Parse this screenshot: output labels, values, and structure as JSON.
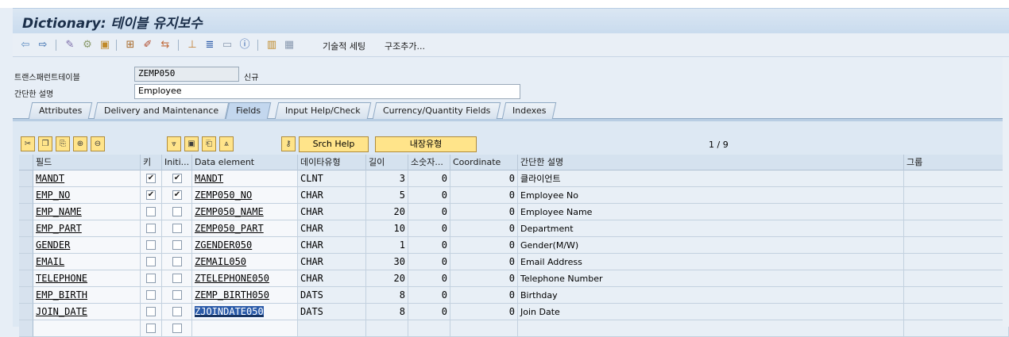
{
  "title": "Dictionary: 테이블 유지보수",
  "toolbar": {
    "tech_settings_label": "기술적 세팅",
    "append_structure_label": "구조추가..."
  },
  "form": {
    "table_label": "트랜스패런트테이블",
    "table_value": "ZEMP050",
    "table_status": "신규",
    "desc_label": "간단한 설명",
    "desc_value": "Employee"
  },
  "tabs": [
    {
      "label": "Attributes"
    },
    {
      "label": "Delivery and Maintenance"
    },
    {
      "label": "Fields"
    },
    {
      "label": "Input Help/Check"
    },
    {
      "label": "Currency/Quantity Fields"
    },
    {
      "label": "Indexes"
    }
  ],
  "buttons": {
    "srch_help": "Srch Help",
    "builtin_type": "내장유형"
  },
  "pager": "1 / 9",
  "columns": {
    "field": "필드",
    "key": "키",
    "initial": "Initi...",
    "data_element": "Data element",
    "data_type": "데이타유형",
    "length": "길이",
    "decimals": "소숫자...",
    "coordinate": "Coordinate",
    "short_desc": "간단한 설명",
    "group": "그룹"
  },
  "rows": [
    {
      "field": "MANDT",
      "key": true,
      "initial": true,
      "data_element": "MANDT",
      "data_type": "CLNT",
      "length": "3",
      "decimals": "0",
      "coordinate": "0",
      "desc": "클라이언트"
    },
    {
      "field": "EMP_NO",
      "key": true,
      "initial": true,
      "data_element": "ZEMP050_NO",
      "data_type": "CHAR",
      "length": "5",
      "decimals": "0",
      "coordinate": "0",
      "desc": "Employee No"
    },
    {
      "field": "EMP_NAME",
      "key": false,
      "initial": false,
      "data_element": "ZEMP050_NAME",
      "data_type": "CHAR",
      "length": "20",
      "decimals": "0",
      "coordinate": "0",
      "desc": "Employee Name"
    },
    {
      "field": "EMP_PART",
      "key": false,
      "initial": false,
      "data_element": "ZEMP050_PART",
      "data_type": "CHAR",
      "length": "10",
      "decimals": "0",
      "coordinate": "0",
      "desc": "Department"
    },
    {
      "field": "GENDER",
      "key": false,
      "initial": false,
      "data_element": "ZGENDER050",
      "data_type": "CHAR",
      "length": "1",
      "decimals": "0",
      "coordinate": "0",
      "desc": "Gender(M/W)"
    },
    {
      "field": "EMAIL",
      "key": false,
      "initial": false,
      "data_element": "ZEMAIL050",
      "data_type": "CHAR",
      "length": "30",
      "decimals": "0",
      "coordinate": "0",
      "desc": "Email Address"
    },
    {
      "field": "TELEPHONE",
      "key": false,
      "initial": false,
      "data_element": "ZTELEPHONE050",
      "data_type": "CHAR",
      "length": "20",
      "decimals": "0",
      "coordinate": "0",
      "desc": "Telephone Number"
    },
    {
      "field": "EMP_BIRTH",
      "key": false,
      "initial": false,
      "data_element": "ZEMP_BIRTH050",
      "data_type": "DATS",
      "length": "8",
      "decimals": "0",
      "coordinate": "0",
      "desc": "Birthday"
    },
    {
      "field": "JOIN_DATE",
      "key": false,
      "initial": false,
      "data_element": "ZJOINDATE050",
      "data_type": "DATS",
      "length": "8",
      "decimals": "0",
      "coordinate": "0",
      "desc": "Join Date"
    }
  ],
  "colors": {
    "selected_data_element": "#2a5aa8",
    "button_yellow": "#ffe48a"
  }
}
